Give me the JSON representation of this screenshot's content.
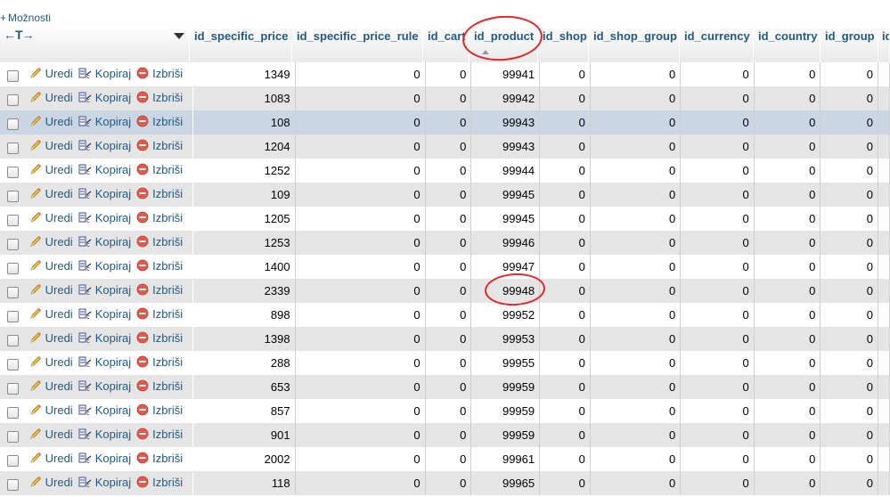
{
  "options_link": "Možnosti",
  "options_plus": "+",
  "arrows": "←T→",
  "columns": [
    "id_specific_price",
    "id_specific_price_rule",
    "id_cart",
    "id_product",
    "id_shop",
    "id_shop_group",
    "id_currency",
    "id_country",
    "id_group",
    "id"
  ],
  "actions": {
    "edit": "Uredi",
    "copy": "Kopiraj",
    "delete": "Izbriši"
  },
  "rows": [
    {
      "id_specific_price": "1349",
      "id_specific_price_rule": "0",
      "id_cart": "0",
      "id_product": "99941",
      "id_shop": "0",
      "id_shop_group": "0",
      "id_currency": "0",
      "id_country": "0",
      "id_group": "0"
    },
    {
      "id_specific_price": "1083",
      "id_specific_price_rule": "0",
      "id_cart": "0",
      "id_product": "99942",
      "id_shop": "0",
      "id_shop_group": "0",
      "id_currency": "0",
      "id_country": "0",
      "id_group": "0"
    },
    {
      "id_specific_price": "108",
      "id_specific_price_rule": "0",
      "id_cart": "0",
      "id_product": "99943",
      "id_shop": "0",
      "id_shop_group": "0",
      "id_currency": "0",
      "id_country": "0",
      "id_group": "0"
    },
    {
      "id_specific_price": "1204",
      "id_specific_price_rule": "0",
      "id_cart": "0",
      "id_product": "99943",
      "id_shop": "0",
      "id_shop_group": "0",
      "id_currency": "0",
      "id_country": "0",
      "id_group": "0"
    },
    {
      "id_specific_price": "1252",
      "id_specific_price_rule": "0",
      "id_cart": "0",
      "id_product": "99944",
      "id_shop": "0",
      "id_shop_group": "0",
      "id_currency": "0",
      "id_country": "0",
      "id_group": "0"
    },
    {
      "id_specific_price": "109",
      "id_specific_price_rule": "0",
      "id_cart": "0",
      "id_product": "99945",
      "id_shop": "0",
      "id_shop_group": "0",
      "id_currency": "0",
      "id_country": "0",
      "id_group": "0"
    },
    {
      "id_specific_price": "1205",
      "id_specific_price_rule": "0",
      "id_cart": "0",
      "id_product": "99945",
      "id_shop": "0",
      "id_shop_group": "0",
      "id_currency": "0",
      "id_country": "0",
      "id_group": "0"
    },
    {
      "id_specific_price": "1253",
      "id_specific_price_rule": "0",
      "id_cart": "0",
      "id_product": "99946",
      "id_shop": "0",
      "id_shop_group": "0",
      "id_currency": "0",
      "id_country": "0",
      "id_group": "0"
    },
    {
      "id_specific_price": "1400",
      "id_specific_price_rule": "0",
      "id_cart": "0",
      "id_product": "99947",
      "id_shop": "0",
      "id_shop_group": "0",
      "id_currency": "0",
      "id_country": "0",
      "id_group": "0"
    },
    {
      "id_specific_price": "2339",
      "id_specific_price_rule": "0",
      "id_cart": "0",
      "id_product": "99948",
      "id_shop": "0",
      "id_shop_group": "0",
      "id_currency": "0",
      "id_country": "0",
      "id_group": "0"
    },
    {
      "id_specific_price": "898",
      "id_specific_price_rule": "0",
      "id_cart": "0",
      "id_product": "99952",
      "id_shop": "0",
      "id_shop_group": "0",
      "id_currency": "0",
      "id_country": "0",
      "id_group": "0"
    },
    {
      "id_specific_price": "1398",
      "id_specific_price_rule": "0",
      "id_cart": "0",
      "id_product": "99953",
      "id_shop": "0",
      "id_shop_group": "0",
      "id_currency": "0",
      "id_country": "0",
      "id_group": "0"
    },
    {
      "id_specific_price": "288",
      "id_specific_price_rule": "0",
      "id_cart": "0",
      "id_product": "99955",
      "id_shop": "0",
      "id_shop_group": "0",
      "id_currency": "0",
      "id_country": "0",
      "id_group": "0"
    },
    {
      "id_specific_price": "653",
      "id_specific_price_rule": "0",
      "id_cart": "0",
      "id_product": "99959",
      "id_shop": "0",
      "id_shop_group": "0",
      "id_currency": "0",
      "id_country": "0",
      "id_group": "0"
    },
    {
      "id_specific_price": "857",
      "id_specific_price_rule": "0",
      "id_cart": "0",
      "id_product": "99959",
      "id_shop": "0",
      "id_shop_group": "0",
      "id_currency": "0",
      "id_country": "0",
      "id_group": "0"
    },
    {
      "id_specific_price": "901",
      "id_specific_price_rule": "0",
      "id_cart": "0",
      "id_product": "99959",
      "id_shop": "0",
      "id_shop_group": "0",
      "id_currency": "0",
      "id_country": "0",
      "id_group": "0"
    },
    {
      "id_specific_price": "2002",
      "id_specific_price_rule": "0",
      "id_cart": "0",
      "id_product": "99961",
      "id_shop": "0",
      "id_shop_group": "0",
      "id_currency": "0",
      "id_country": "0",
      "id_group": "0"
    },
    {
      "id_specific_price": "118",
      "id_specific_price_rule": "0",
      "id_cart": "0",
      "id_product": "99965",
      "id_shop": "0",
      "id_shop_group": "0",
      "id_currency": "0",
      "id_country": "0",
      "id_group": "0"
    }
  ],
  "highlighted_row": 2,
  "colors": {
    "link": "#235a81",
    "annotation": "#e3262a",
    "row_even": "#e5e5e5",
    "row_highlight": "#cad6e4"
  },
  "icons": {
    "edit": "pencil-icon",
    "copy": "copy-icon",
    "delete": "delete-icon",
    "sort": "sort-ascending-icon",
    "dropdown": "column-dropdown-icon"
  }
}
